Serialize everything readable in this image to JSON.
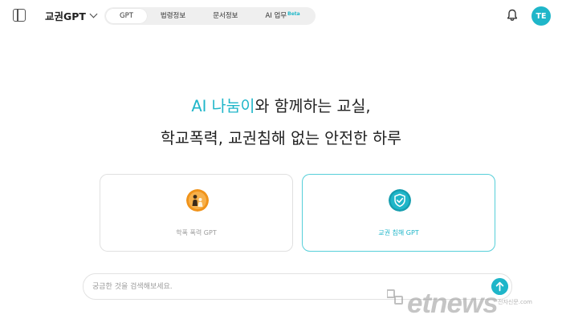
{
  "header": {
    "model_name": "교권GPT",
    "tabs": [
      {
        "label": "GPT",
        "active": true
      },
      {
        "label": "법령정보",
        "active": false
      },
      {
        "label": "문서정보",
        "active": false
      },
      {
        "label": "AI 업무",
        "active": false,
        "badge": "Beta"
      }
    ],
    "avatar_initials": "TE",
    "icons": [
      "sidebar-toggle-icon",
      "chevron-down-icon",
      "bell-icon"
    ]
  },
  "hero": {
    "line1_highlight": "AI 나눔이",
    "line1_rest": "와 함께하는 교실,",
    "line2": "학교폭력, 교권침해 없는 안전한 하루"
  },
  "cards": [
    {
      "label": "학폭 폭력 GPT",
      "icon": "school-violence-icon",
      "selected": false
    },
    {
      "label": "교권 침해 GPT",
      "icon": "shield-icon",
      "selected": true
    }
  ],
  "search": {
    "placeholder": "궁금한 것을 검색해보세요.",
    "value": ""
  },
  "watermark": {
    "text": "etnews",
    "sub": "전자신문",
    "suffix": ".com"
  },
  "colors": {
    "accent": "#1fb6c9",
    "card_border": "#e0e0e0",
    "tab_bg": "#efefef"
  }
}
